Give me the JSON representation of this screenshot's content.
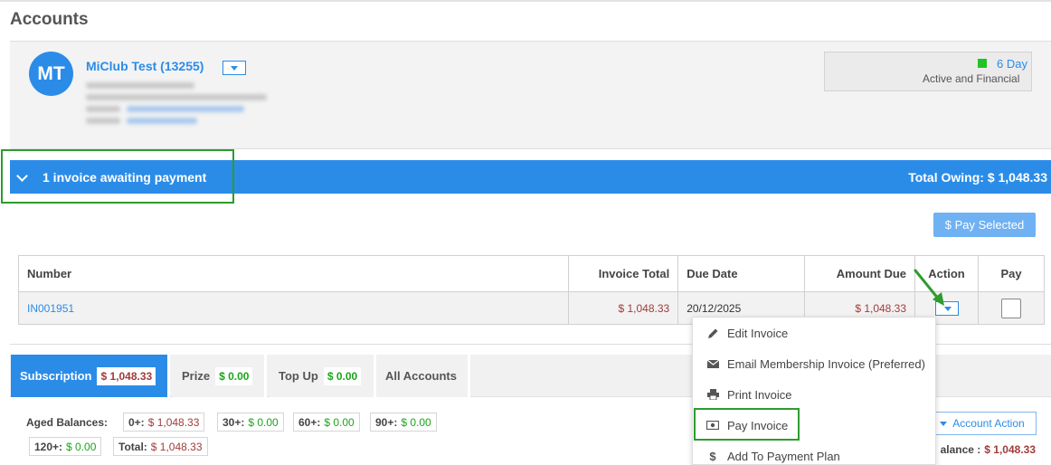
{
  "page_title": "Accounts",
  "member": {
    "initials": "MT",
    "name": "MiClub Test (13255)"
  },
  "status": {
    "days": "6 Day",
    "text": "Active and Financial",
    "indicator_color": "#22c322"
  },
  "invoice_bar": {
    "title": "1 invoice awaiting payment",
    "total_owing": "Total Owing: $ 1,048.33"
  },
  "pay_selected_label": "$ Pay Selected",
  "invoice_table": {
    "headers": {
      "number": "Number",
      "invoice_total": "Invoice Total",
      "due_date": "Due Date",
      "amount_due": "Amount Due",
      "action": "Action",
      "pay": "Pay"
    },
    "rows": [
      {
        "number": "IN001951",
        "invoice_total": "$ 1,048.33",
        "due_date": "20/12/2025",
        "amount_due": "$ 1,048.33"
      }
    ]
  },
  "action_menu": {
    "items": [
      {
        "label": "Edit Invoice",
        "icon": "pencil-icon"
      },
      {
        "label": "Email Membership Invoice (Preferred)",
        "icon": "envelope-icon"
      },
      {
        "label": "Print Invoice",
        "icon": "printer-icon"
      },
      {
        "label": "Pay Invoice",
        "icon": "money-icon"
      },
      {
        "label": "Add To Payment Plan",
        "icon": "dollar-icon"
      }
    ]
  },
  "tabs": [
    {
      "label": "Subscription",
      "amount": "$ 1,048.33"
    },
    {
      "label": "Prize",
      "amount": "$ 0.00"
    },
    {
      "label": "Top Up",
      "amount": "$ 0.00"
    },
    {
      "label": "All Accounts",
      "amount": ""
    }
  ],
  "aged_balances": {
    "label": "Aged Balances:",
    "items": [
      {
        "key": "0+:",
        "value": "$ 1,048.33"
      },
      {
        "key": "30+:",
        "value": "$ 0.00"
      },
      {
        "key": "60+:",
        "value": "$ 0.00"
      },
      {
        "key": "90+:",
        "value": "$ 0.00"
      },
      {
        "key": "120+:",
        "value": "$ 0.00"
      },
      {
        "key": "Total:",
        "value": "$ 1,048.33"
      }
    ]
  },
  "account_action_label": "Account Action",
  "balance": {
    "label": "alance :",
    "value": "$ 1,048.33"
  },
  "colors": {
    "primary": "#2b8ce8",
    "negative": "#a33a3a",
    "positive": "#1aa51a",
    "highlight": "#2e9b2e"
  }
}
